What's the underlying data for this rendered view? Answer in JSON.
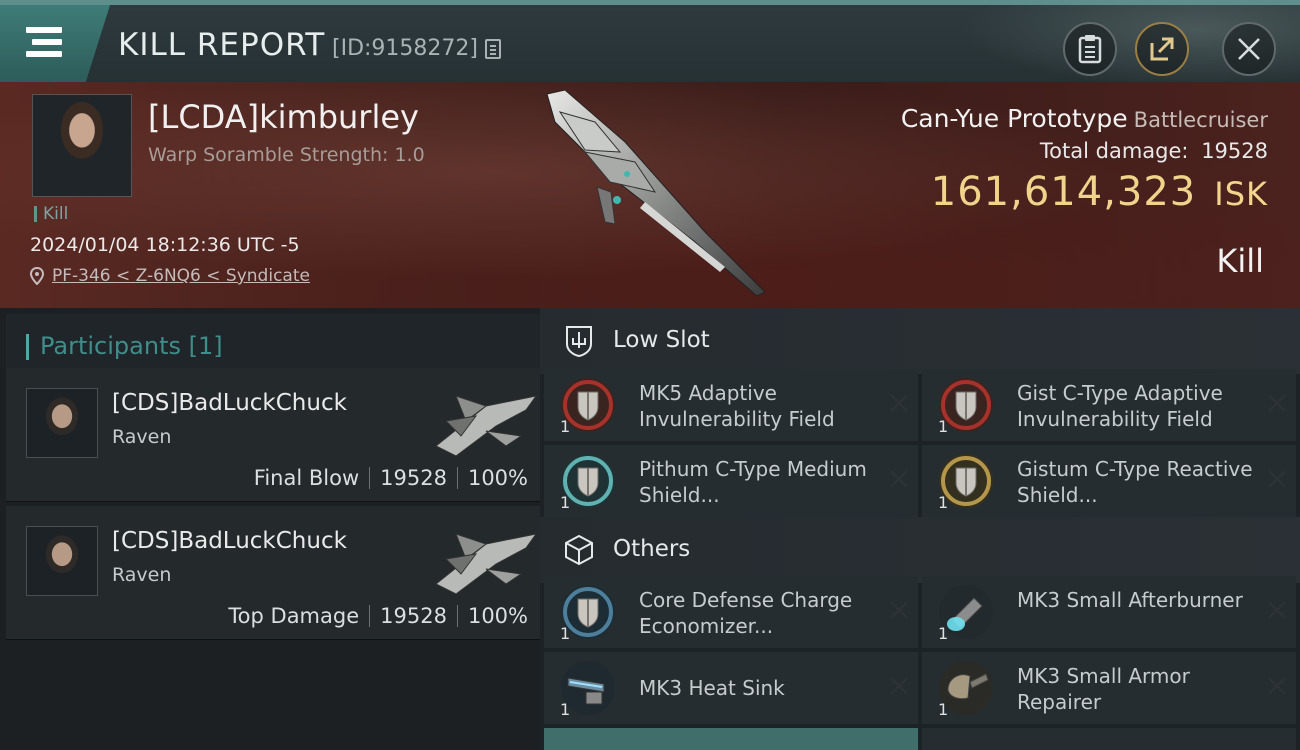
{
  "header": {
    "title": "KILL REPORT",
    "kill_id": "[ID:9158272]"
  },
  "victim": {
    "name": "[LCDA]kimburley",
    "subtitle": "Warp Soramble Strength: 1.0",
    "tag": "Kill",
    "datetime": "2024/01/04 18:12:36 UTC -5",
    "location": "PF-346 < Z-6NQ6 < Syndicate"
  },
  "ship": {
    "name": "Can-Yue Prototype",
    "class": "Battlecruiser",
    "damage_label": "Total damage:",
    "damage_value": "19528",
    "isk_value": "161,614,323",
    "isk_unit": "ISK",
    "result": "Kill"
  },
  "participants": {
    "title": "Participants",
    "count": "[1]",
    "rows": [
      {
        "name": "[CDS]BadLuckChuck",
        "ship": "Raven",
        "role": "Final Blow",
        "damage": "19528",
        "percent": "100%"
      },
      {
        "name": "[CDS]BadLuckChuck",
        "ship": "Raven",
        "role": "Top Damage",
        "damage": "19528",
        "percent": "100%"
      }
    ]
  },
  "fitting": {
    "low_slot": {
      "title": "Low Slot",
      "modules": [
        {
          "name": "MK5 Adaptive Invulnerability Field",
          "qty": "1",
          "icon": "red-shield-icon"
        },
        {
          "name": "Gist C-Type Adaptive Invulnerability Field",
          "qty": "1",
          "icon": "red-shield-icon"
        },
        {
          "name": "Pithum C-Type Medium Shield...",
          "qty": "1",
          "icon": "teal-shield-icon"
        },
        {
          "name": "Gistum C-Type Reactive Shield...",
          "qty": "1",
          "icon": "gold-shield-icon"
        }
      ]
    },
    "others": {
      "title": "Others",
      "modules": [
        {
          "name": "Core Defense Charge Economizer...",
          "qty": "1",
          "icon": "blue-shield-icon"
        },
        {
          "name": "MK3 Small Afterburner",
          "qty": "1",
          "icon": "afterburner-icon"
        },
        {
          "name": "MK3 Heat Sink",
          "qty": "1",
          "icon": "heat-sink-icon"
        },
        {
          "name": "MK3 Small Armor Repairer",
          "qty": "1",
          "icon": "armor-repairer-icon"
        }
      ]
    }
  },
  "colors": {
    "accent_teal": "#3f8e8b",
    "isk_gold": "#f0d48c",
    "banner_red": "#4b221e"
  }
}
